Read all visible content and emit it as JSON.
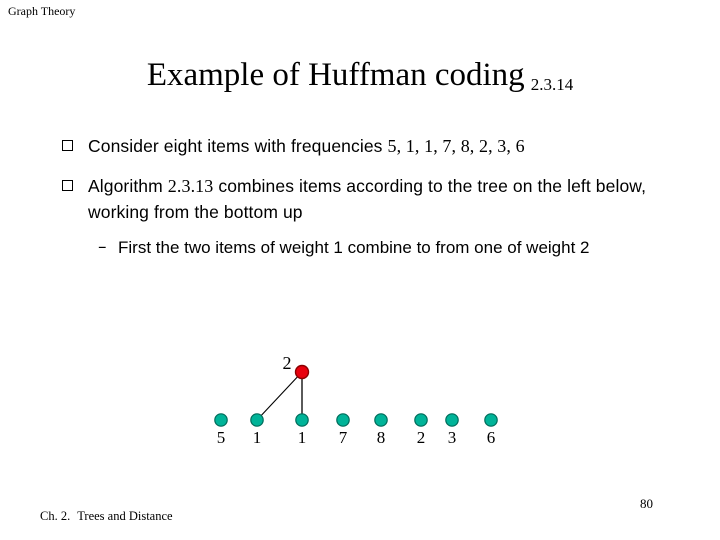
{
  "header": {
    "text": "Graph Theory"
  },
  "title": {
    "main": "Example of Huffman coding",
    "reference": "2.3.14"
  },
  "body": {
    "bullets": [
      {
        "marker": "hollow-square-bullet",
        "text_before": "Consider eight items with frequencies ",
        "numbers": "5, 1, 1, 7, 8, 2, 3, 6",
        "text_after": ""
      },
      {
        "marker": "hollow-square-bullet",
        "text_before": "Algorithm ",
        "numbers": "2.3.13",
        "text_after": " combines items according to the tree on the left below, working from the bottom up"
      }
    ],
    "subbullet": {
      "marker": "–",
      "text": "First the two items of weight 1 combine to from one of weight 2"
    }
  },
  "diagram": {
    "type": "huffman-tree-partial",
    "leaf_labels": [
      "5",
      "1",
      "1",
      "7",
      "8",
      "2",
      "3",
      "6"
    ],
    "leaf_color": "#00B398",
    "leaf_stroke": "#006B5A",
    "internal_nodes": [
      {
        "label": "2",
        "color": "#E8000D",
        "stroke": "#8B0000"
      }
    ],
    "edges": [
      {
        "from": "internal-2",
        "to": "leaf-1-second"
      },
      {
        "from": "internal-2",
        "to": "leaf-1-third"
      }
    ],
    "edge_color": "#000000"
  },
  "footer": {
    "chapter": "Ch. 2.",
    "chapter_title": "Trees and Distance",
    "page_number": "80"
  }
}
